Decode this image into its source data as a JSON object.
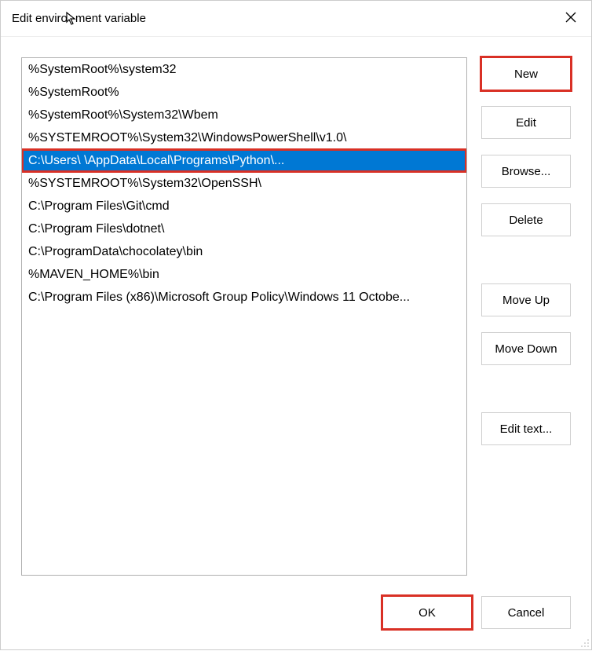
{
  "title": {
    "prefix": "Edit enviro",
    "suffix": "ment variable"
  },
  "buttons": {
    "new": "New",
    "edit": "Edit",
    "browse": "Browse...",
    "delete": "Delete",
    "move_up": "Move Up",
    "move_down": "Move Down",
    "edit_text": "Edit text...",
    "ok": "OK",
    "cancel": "Cancel"
  },
  "list": {
    "items": [
      "%SystemRoot%\\system32",
      "%SystemRoot%",
      "%SystemRoot%\\System32\\Wbem",
      "%SYSTEMROOT%\\System32\\WindowsPowerShell\\v1.0\\",
      "C:\\Users\\                                      \\AppData\\Local\\Programs\\Python\\...",
      "%SYSTEMROOT%\\System32\\OpenSSH\\",
      "C:\\Program Files\\Git\\cmd",
      "C:\\Program Files\\dotnet\\",
      "C:\\ProgramData\\chocolatey\\bin",
      "%MAVEN_HOME%\\bin",
      "C:\\Program Files (x86)\\Microsoft Group Policy\\Windows 11 Octobe..."
    ],
    "selected_index": 4,
    "highlighted_index": 4
  }
}
